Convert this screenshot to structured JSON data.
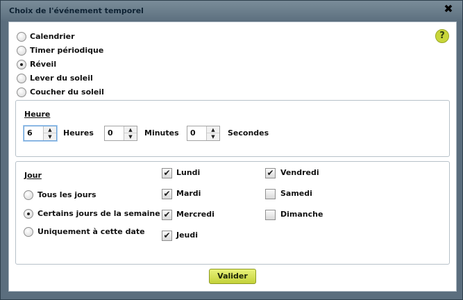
{
  "dialog": {
    "title": "Choix de l'événement temporel",
    "close_glyph": "✖",
    "help_glyph": "?"
  },
  "event_types": [
    {
      "label": "Calendrier",
      "selected": false
    },
    {
      "label": "Timer périodique",
      "selected": false
    },
    {
      "label": "Réveil",
      "selected": true
    },
    {
      "label": "Lever du soleil",
      "selected": false
    },
    {
      "label": "Coucher du soleil",
      "selected": false
    }
  ],
  "heure": {
    "label": "Heure",
    "hours_value": "6",
    "hours_label": "Heures",
    "minutes_value": "0",
    "minutes_label": "Minutes",
    "seconds_value": "0",
    "seconds_label": "Secondes"
  },
  "jour": {
    "label": "Jour",
    "options": [
      {
        "label": "Tous les jours",
        "selected": false
      },
      {
        "label": "Certains jours de la semaine",
        "selected": true
      },
      {
        "label": "Uniquement à cette date",
        "selected": false
      }
    ],
    "days": [
      {
        "label": "Lundi",
        "checked": true
      },
      {
        "label": "Mardi",
        "checked": true
      },
      {
        "label": "Mercredi",
        "checked": true
      },
      {
        "label": "Jeudi",
        "checked": true
      },
      {
        "label": "Vendredi",
        "checked": true
      },
      {
        "label": "Samedi",
        "checked": false
      },
      {
        "label": "Dimanche",
        "checked": false
      }
    ]
  },
  "buttons": {
    "validate_label": "Valider"
  },
  "colors": {
    "accent": "#c8d63a",
    "titlebar": "#6b7e8d"
  }
}
